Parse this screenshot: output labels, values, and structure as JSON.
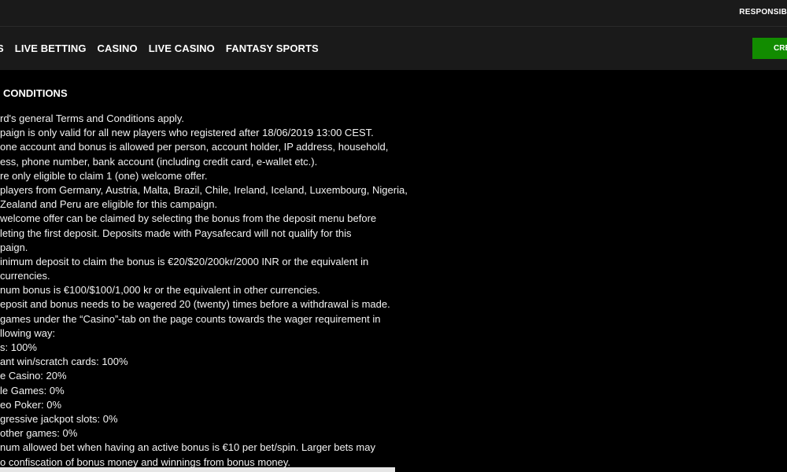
{
  "topbar": {
    "responsible_text": "RESPONSIB"
  },
  "nav": {
    "items": [
      {
        "label": "S"
      },
      {
        "label": "LIVE BETTING"
      },
      {
        "label": "CASINO"
      },
      {
        "label": "LIVE CASINO"
      },
      {
        "label": "FANTASY SPORTS"
      }
    ],
    "cta_label": "CRE"
  },
  "terms": {
    "heading": "& CONDITIONS",
    "lines": [
      "rd's general Terms and Conditions apply.",
      "paign is only valid for all new players who registered after 18/06/2019 13:00 CEST.",
      "one account and bonus is allowed per person, account holder, IP address, household,",
      "ess, phone number, bank account (including credit card, e-wallet etc.).",
      "re only eligible to claim 1 (one) welcome offer.",
      "players from Germany, Austria, Malta, Brazil, Chile, Ireland, Iceland, Luxembourg, Nigeria,",
      "Zealand and Peru are eligible for this campaign.",
      "welcome offer can be claimed by selecting the bonus from the deposit menu before",
      "leting the first deposit. Deposits made with Paysafecard will not qualify for this",
      "paign.",
      "inimum deposit to claim the bonus is €20/$20/200kr/2000 INR or the equivalent in",
      "currencies.",
      "num bonus is €100/$100/1,000 kr or the equivalent in other currencies.",
      "eposit and bonus needs to be wagered 20 (twenty) times before a withdrawal is made.",
      "games under the “Casino”-tab on the page counts towards the wager requirement in",
      "llowing way:",
      "s: 100%",
      "ant win/scratch cards: 100%",
      "e Casino: 20%",
      "le Games: 0%",
      "eo Poker: 0%",
      "gressive jackpot slots: 0%",
      "other games: 0%",
      "num allowed bet when having an active bonus is €10 per bet/spin. Larger bets may",
      "o confiscation of bonus money and winnings from bonus money."
    ]
  },
  "colors": {
    "background": "#000000",
    "header": "#1a1a1a",
    "cta": "#128c00",
    "text": "#ffffff"
  }
}
